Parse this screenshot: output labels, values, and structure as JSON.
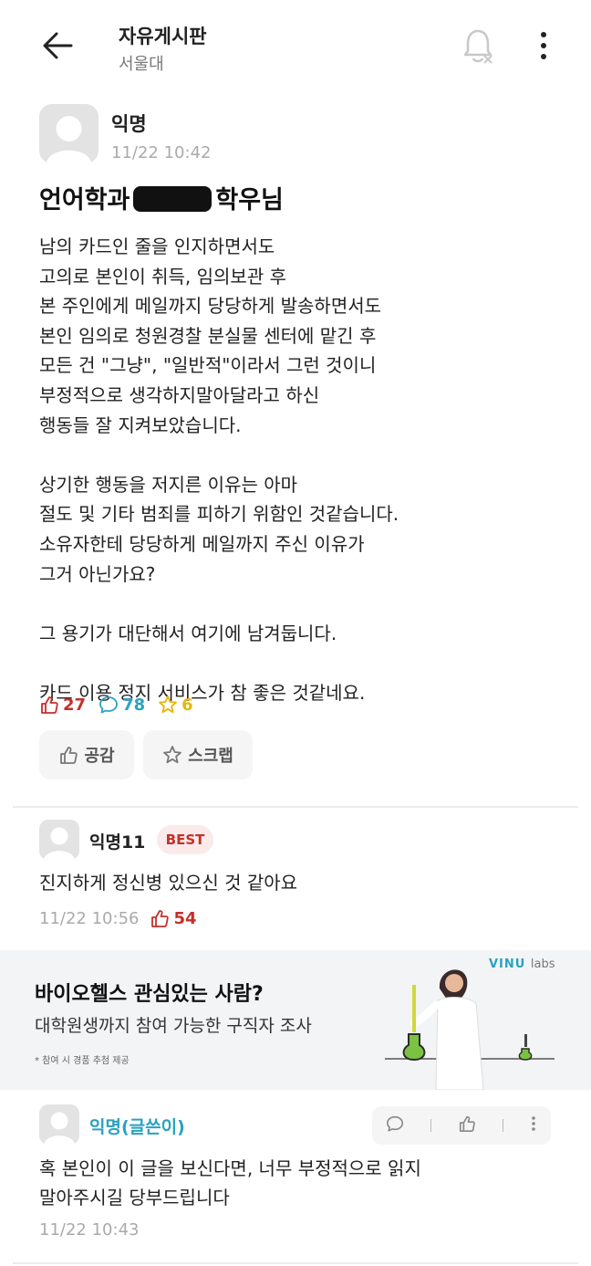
{
  "header": {
    "board_title": "자유게시판",
    "school": "서울대",
    "icons": [
      "back-arrow-icon",
      "bell-off-icon",
      "more-vertical-icon"
    ]
  },
  "post": {
    "author": "익명",
    "time": "11/22 10:42",
    "title_prefix": "언어학과",
    "title_suffix": "학우님",
    "body": "남의 카드인 줄을 인지하면서도\n고의로 본인이 취득, 임의보관 후\n본 주인에게 메일까지 당당하게 발송하면서도\n본인 임의로 청원경찰 분실물 센터에 맡긴 후\n모든 건 \"그냥\", \"일반적\"이라서 그런 것이니\n부정적으로 생각하지말아달라고 하신\n행동들 잘 지켜보았습니다.\n\n상기한 행동을 저지른 이유는 아마\n절도 및 기타 범죄를 피하기 위함인 것같습니다.\n소유자한테 당당하게 메일까지 주신 이유가\n그거 아닌가요?\n\n그 용기가 대단해서 여기에 남겨둡니다.\n\n카드 이용 정지 서비스가 참 좋은 것같네요.",
    "stats": {
      "likes": "27",
      "comments": "78",
      "scraps": "6"
    },
    "buttons": {
      "like": "공감",
      "scrap": "스크랩"
    }
  },
  "comments": [
    {
      "author": "익명11",
      "badge": "BEST",
      "body": "진지하게 정신병 있으신 것 같아요",
      "time": "11/22 10:56",
      "likes": "54"
    },
    {
      "author": "익명(글쓴이)",
      "body": "혹 본인이 이 글을 보신다면, 너무 부정적으로 읽지\n말아주시길 당부드립니다",
      "time": "11/22 10:43"
    }
  ],
  "ad": {
    "title": "바이오헬스 관심있는 사람?",
    "subtitle": "대학원생까지 참여 가능한 구직자 조사",
    "note": "* 참여 시 경품 추첨 제공",
    "brand": "VINU",
    "brand_suffix": "labs"
  },
  "colors": {
    "like": "#c4302b",
    "comment": "#2aa2c0",
    "scrap": "#e8b50d",
    "muted": "#aaaaaa"
  }
}
